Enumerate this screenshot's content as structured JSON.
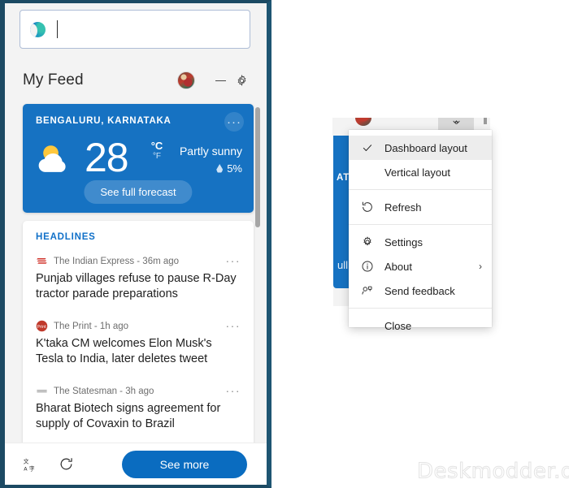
{
  "panel": {
    "search": {
      "placeholder": "",
      "value": "",
      "icon": "edge-logo-icon"
    },
    "header": {
      "title": "My Feed",
      "avatar": "user-avatar",
      "minimize_label": "Minimize",
      "settings_label": "Settings"
    },
    "weather": {
      "location": "BENGALURU, KARNATAKA",
      "temperature": "28",
      "unit_primary": "°C",
      "unit_secondary": "°F",
      "condition": "Partly sunny",
      "precipitation": "5%",
      "forecast_button": "See full forecast",
      "more_options": "···",
      "card_color": "#1672c2",
      "icon": "partly-sunny-icon"
    },
    "news": {
      "section_label": "HEADLINES",
      "items": [
        {
          "source": "The Indian Express - 36m ago",
          "title": "Punjab villages refuse to pause R-Day tractor parade preparations",
          "logo": "indian-express-logo",
          "logo_color": "#d0342c",
          "more": "···"
        },
        {
          "source": "The Print - 1h ago",
          "title": "K'taka CM welcomes Elon Musk's Tesla to India, later deletes tweet",
          "logo": "the-print-logo",
          "logo_color": "#c0392b",
          "more": "···"
        },
        {
          "source": "The Statesman - 3h ago",
          "title": "Bharat Biotech signs agreement for supply of Covaxin to Brazil",
          "logo": "the-statesman-logo",
          "logo_color": "#9a9a9a",
          "more": "···"
        }
      ]
    },
    "footer": {
      "translate_label": "Translate",
      "refresh_label": "Refresh",
      "see_more": "See more",
      "accent": "#0a6cc0"
    }
  },
  "background_flyout": {
    "weather_text_top": "ATA",
    "weather_text_bottom": "ull"
  },
  "context_menu": {
    "items": [
      {
        "label": "Dashboard layout",
        "icon": "check-icon",
        "checked": true
      },
      {
        "label": "Vertical layout",
        "icon": "none",
        "checked": false
      },
      {
        "label": "Refresh",
        "icon": "refresh-icon",
        "checked": false
      },
      {
        "label": "Settings",
        "icon": "gear-icon",
        "checked": false
      },
      {
        "label": "About",
        "icon": "info-icon",
        "checked": false,
        "submenu": "›"
      },
      {
        "label": "Send feedback",
        "icon": "feedback-icon",
        "checked": false
      },
      {
        "label": "Close",
        "icon": "none",
        "checked": false
      }
    ]
  },
  "watermark": {
    "text": "Deskmodder.de"
  }
}
